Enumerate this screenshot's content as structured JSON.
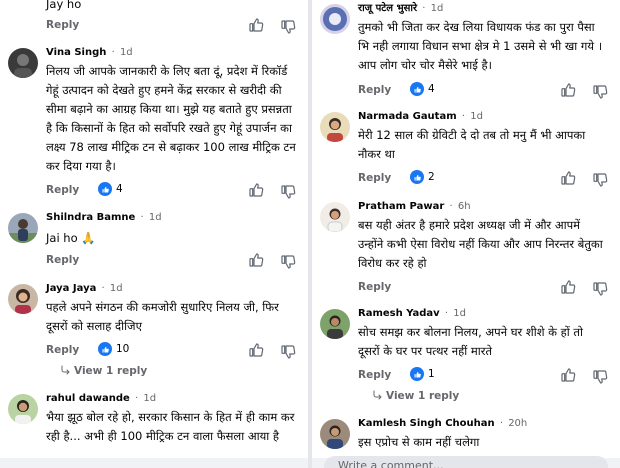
{
  "left": {
    "c0": {
      "body": "Jay ho",
      "reply": "Reply"
    },
    "c1": {
      "name": "Vina Singh",
      "sep": "·",
      "time": "1d",
      "body": "निलय जी आपके जानकारी के लिए बता दूं, प्रदेश में रिकॉर्ड गेहूं उत्पादन को देखते हुए  हमने केंद्र सरकार से खरीदी की सीमा बढ़ाने का आग्रह किया था। मुझे यह बताते हुए प्रसन्नता है कि किसानों के हित को सर्वोपरि रखते हुए गेहूं उपार्जन का लक्ष्य 78 लाख मीट्रिक टन से बढ़ाकर 100 लाख मीट्रिक टन कर दिया गया है।",
      "reply": "Reply",
      "reactions": "4"
    },
    "c2": {
      "name": "Shilndra Bamne",
      "sep": "·",
      "time": "1d",
      "body": "Jai ho 🙏",
      "reply": "Reply"
    },
    "c3": {
      "name": "Jaya Jaya",
      "sep": "·",
      "time": "1d",
      "body": "पहले अपने संगठन की कमजोरी सुधारिए निलय जी, फिर दूसरों को सलाह दीजिए",
      "reply": "Reply",
      "reactions": "10",
      "view_reply": "View 1 reply"
    },
    "c4": {
      "name": "rahul dawande",
      "sep": "·",
      "time": "1d",
      "body": "भैया झूठ बोल रहे हो, सरकार किसान के हित में ही काम कर रही है... अभी ही 100 मीट्रिक टन वाला फैसला आया है"
    }
  },
  "right": {
    "c0": {
      "name": "राजू पटेल भुसारे",
      "sep": "·",
      "time": "1d",
      "body": "तुमको भी जिता कर देख लिया विधायक फंड का पुरा पैसा भि नही लगाया विधान सभा क्षेत्र मे 1 उसमे से भी खा गये । आप लोग चोर चोर मैसेरे भाई है।",
      "reply": "Reply",
      "reactions": "4"
    },
    "c1": {
      "name": "Narmada Gautam",
      "sep": "·",
      "time": "1d",
      "body": "मेरी 12 साल की ग्रेविटी दे दो तब तो मनु मैं भी आपका नौकर था",
      "reply": "Reply",
      "reactions": "2"
    },
    "c2": {
      "name": "Pratham Pawar",
      "sep": "·",
      "time": "6h",
      "body": "बस यही अंतर है हमारे प्रदेश अध्यक्ष जी में और आपमें उन्होंने कभी ऐसा विरोध नहीं किया और आप निरन्तर बेतुका विरोध कर रहे हो",
      "reply": "Reply"
    },
    "c3": {
      "name": "Ramesh Yadav",
      "sep": "·",
      "time": "1d",
      "body": "सोच समझ कर बोलना निलय, अपने घर शीशे के हों तो दूसरों के घर पर पत्थर नहीं मारते",
      "reply": "Reply",
      "reactions": "1",
      "view_reply": "View 1 reply"
    },
    "c4": {
      "name": "Kamlesh Singh Chouhan",
      "sep": "·",
      "time": "20h",
      "body": "इस एप्रोच से काम नहीं चलेगा"
    },
    "input_placeholder": "Write a comment..."
  },
  "icons": {
    "like": "thumbs-up-icon",
    "dislike": "thumbs-down-icon",
    "reaction_badge": "like-reaction-icon",
    "reply_arrow": "reply-arrow-icon"
  },
  "colors": {
    "accent": "#1877f2",
    "text": "#050505",
    "muted": "#65676b",
    "divider": "#e4e6eb"
  }
}
